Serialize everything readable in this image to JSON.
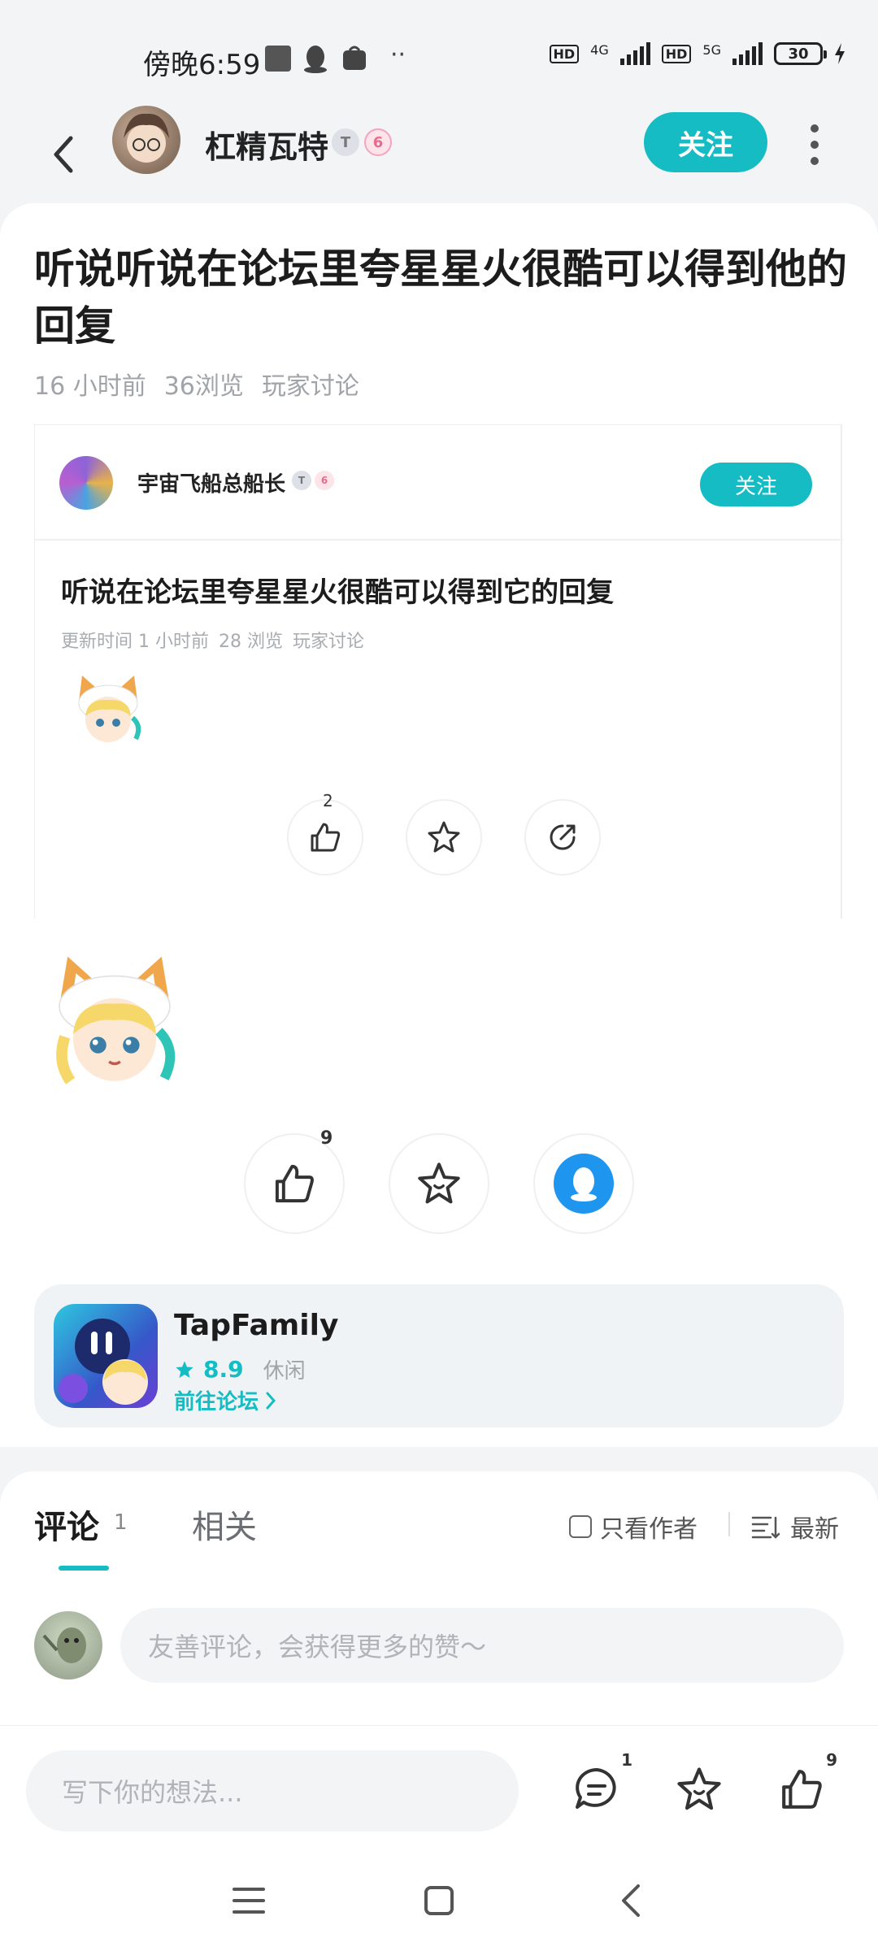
{
  "status_bar": {
    "time": "傍晚6:59",
    "network_1": "4G",
    "network_2": "5G",
    "hd": "HD",
    "battery": "30"
  },
  "header": {
    "author_name": "杠精瓦特",
    "follow_label": "关注"
  },
  "post": {
    "title": "听说听说在论坛里夸星星火很酷可以得到他的回复",
    "time": "16 小时前",
    "views": "36浏览",
    "category": "玩家讨论"
  },
  "embedded_post": {
    "author_name": "宇宙飞船总船长",
    "follow_label": "关注",
    "title": "听说在论坛里夸星星火很酷可以得到它的回复",
    "updated": "更新时间 1 小时前",
    "views": "28 浏览",
    "category": "玩家讨论",
    "like_count": "2"
  },
  "actions": {
    "like_count": "9"
  },
  "app_card": {
    "name": "TapFamily",
    "score": "8.9",
    "genre": "休闲",
    "forum_link": "前往论坛"
  },
  "comments": {
    "tab_comments": "评论",
    "comment_count": "1",
    "tab_related": "相关",
    "only_author": "只看作者",
    "sort": "最新",
    "input_placeholder": "友善评论，会获得更多的赞～"
  },
  "bottom_bar": {
    "input_placeholder": "写下你的想法...",
    "comment_count": "1",
    "like_count": "9"
  },
  "colors": {
    "accent": "#16bcc3",
    "qq_blue": "#1e96f0"
  }
}
